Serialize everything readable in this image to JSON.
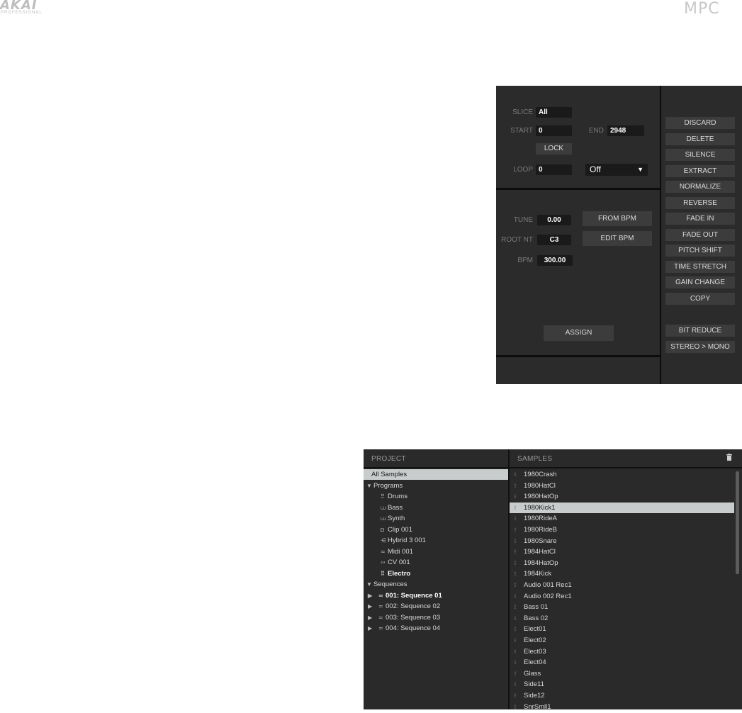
{
  "header": {
    "akai_logo": "AKAI",
    "akai_sub": "PROFESSIONAL",
    "mpc_logo": "MPC"
  },
  "edit": {
    "slice_label": "SLICE",
    "slice_value": "All",
    "start_label": "START",
    "start_value": "0",
    "end_label": "END",
    "end_value": "2948",
    "lock_label": "LOCK",
    "loop_label": "LOOP",
    "loop_value": "0",
    "loop_mode": "Off",
    "tune_label": "TUNE",
    "tune_value": "0.00",
    "rootnt_label": "ROOT NT",
    "rootnt_value": "C3",
    "bpm_label": "BPM",
    "bpm_value": "300.00",
    "from_bpm": "FROM BPM",
    "edit_bpm": "EDIT BPM",
    "assign": "ASSIGN",
    "process_buttons": [
      "DISCARD",
      "DELETE",
      "SILENCE",
      "EXTRACT",
      "NORMALIZE",
      "REVERSE",
      "FADE IN",
      "FADE OUT",
      "PITCH SHIFT",
      "TIME STRETCH",
      "GAIN CHANGE",
      "COPY"
    ],
    "process_buttons_2": [
      "BIT REDUCE",
      "STEREO > MONO"
    ]
  },
  "browser": {
    "project_header": "PROJECT",
    "samples_header": "SAMPLES",
    "all_samples": "All Samples",
    "programs_label": "Programs",
    "programs": [
      {
        "icon": "drum-grid-icon",
        "glyph": "⠿",
        "label": "Drums"
      },
      {
        "icon": "keys-icon",
        "glyph": "⩊",
        "label": "Bass"
      },
      {
        "icon": "keys-icon",
        "glyph": "⩊",
        "label": "Synth"
      },
      {
        "icon": "clip-icon",
        "glyph": "◘",
        "label": "Clip 001"
      },
      {
        "icon": "hybrid-icon",
        "glyph": "⋲",
        "label": "Hybrid 3 001"
      },
      {
        "icon": "midi-icon",
        "glyph": "≂",
        "label": "Midi 001"
      },
      {
        "icon": "cv-icon",
        "glyph": "∾",
        "label": "CV 001"
      },
      {
        "icon": "drum-grid-icon",
        "glyph": "⠿",
        "label": "Electro"
      }
    ],
    "sequences_label": "Sequences",
    "sequences": [
      "001: Sequence 01",
      "002: Sequence 02",
      "003: Sequence 03",
      "004: Sequence 04"
    ],
    "samples": [
      "1980Crash",
      "1980HatCl",
      "1980HatOp",
      "1980Kick1",
      "1980RideA",
      "1980RideB",
      "1980Snare",
      "1984HatCl",
      "1984HatOp",
      "1984Kick",
      "Audio 001 Rec1",
      "Audio 002 Rec1",
      "Bass 01",
      "Bass 02",
      "Elect01",
      "Elect02",
      "Elect03",
      "Elect04",
      "Glass",
      "Side11",
      "Side12",
      "SnrSmll1"
    ],
    "selected_sample": "1980Kick1"
  }
}
